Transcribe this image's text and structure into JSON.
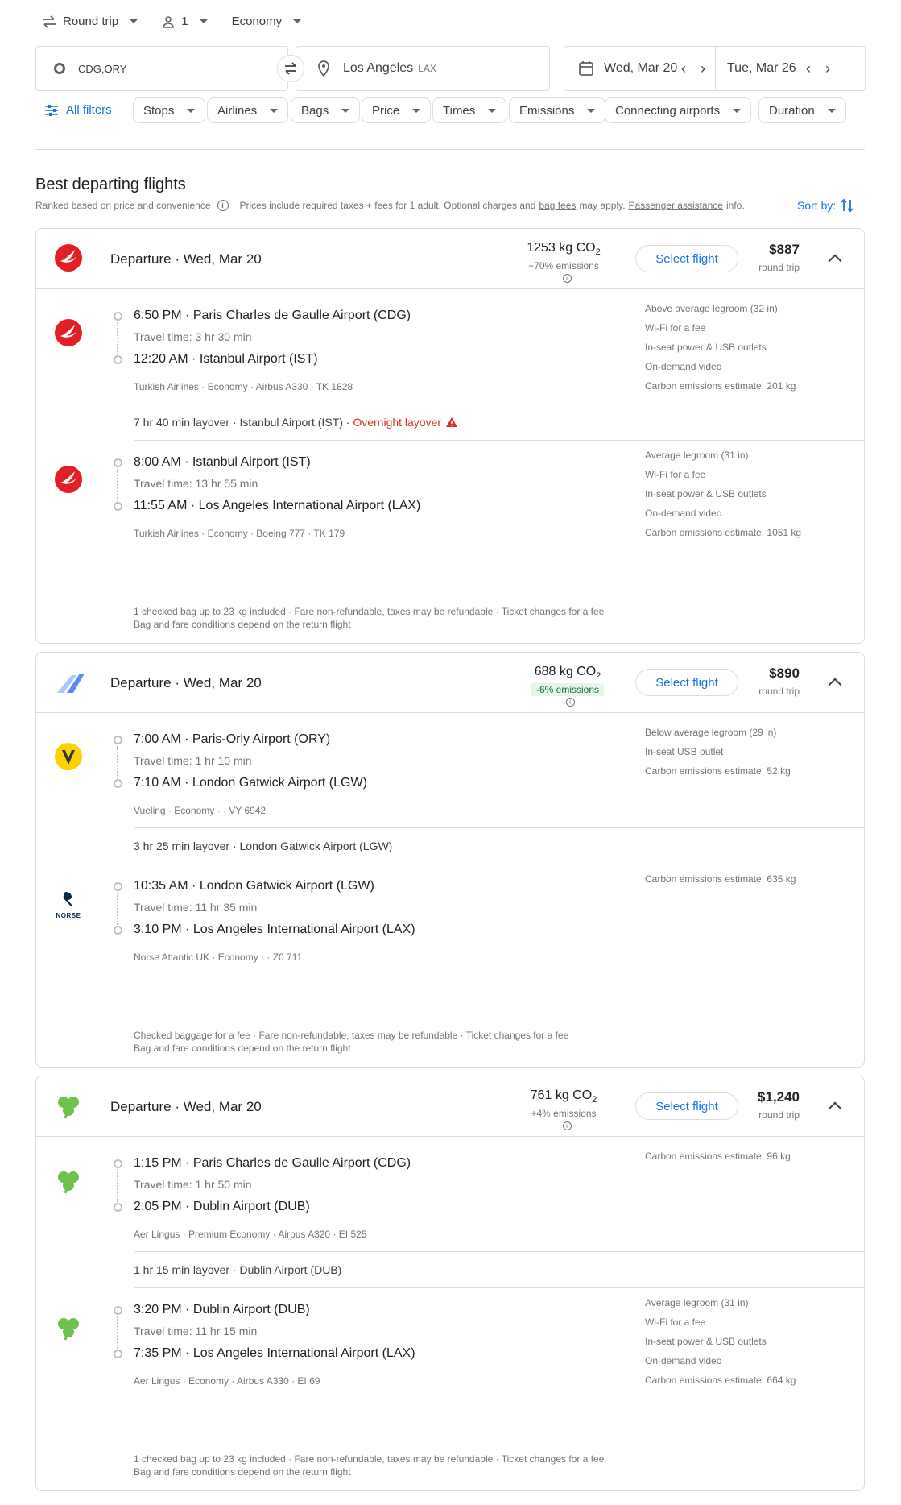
{
  "search": {
    "trip_type": "Round trip",
    "passengers": "1",
    "cabin": "Economy",
    "origin": "CDG,ORY",
    "destination": "Los Angeles",
    "destination_code": "LAX",
    "depart_date": "Wed, Mar 20",
    "return_date": "Tue, Mar 26"
  },
  "filters": {
    "all_filters": "All filters",
    "chips": [
      "Stops",
      "Airlines",
      "Bags",
      "Price",
      "Times",
      "Emissions",
      "Connecting airports",
      "Duration"
    ]
  },
  "results": {
    "heading": "Best departing flights",
    "subtext": "Ranked based on price and convenience",
    "prices_note_1": "Prices include required taxes + fees for 1 adult. Optional charges and",
    "bag_fees_link": "bag fees",
    "prices_note_2": "may apply.",
    "assistance_link": "Passenger assistance",
    "prices_note_3": "info.",
    "sort_by": "Sort by:"
  },
  "colors": {
    "accent": "#1a73e8",
    "turkish_red": "#e21f26",
    "vueling_yellow": "#fcd100",
    "aer_lingus_green": "#6cc24a",
    "warning_red": "#d93025"
  },
  "flights": [
    {
      "departure_label": "Departure",
      "date": "Wed, Mar 20",
      "co2_value": "1253 kg CO",
      "co2_sub": "2",
      "emissions": "+70% emissions",
      "select_label": "Select flight",
      "price": "$887",
      "price_sub": "round trip",
      "segments": [
        {
          "logo": "turkish-airlines-logo",
          "dep_time": "6:50 PM",
          "dep_airport": "Paris Charles de Gaulle Airport (CDG)",
          "travel_time": "Travel time: 3 hr 30 min",
          "arr_time": "12:20 AM",
          "arr_airport": "Istanbul Airport (IST)",
          "meta": "Turkish Airlines · Economy · Airbus A330 · TK 1828",
          "features": [
            "Above average legroom (32 in)",
            "Wi-Fi for a fee",
            "In-seat power & USB outlets",
            "On-demand video",
            "Carbon emissions estimate: 201 kg"
          ]
        },
        {
          "logo": "turkish-airlines-logo",
          "dep_time": "8:00 AM",
          "dep_airport": "Istanbul Airport (IST)",
          "travel_time": "Travel time: 13 hr 55 min",
          "arr_time": "11:55 AM",
          "arr_airport": "Los Angeles International Airport (LAX)",
          "meta": "Turkish Airlines · Economy · Boeing 777 · TK 179",
          "features": [
            "Average legroom (31 in)",
            "Wi-Fi for a fee",
            "In-seat power & USB outlets",
            "On-demand video",
            "Carbon emissions estimate: 1051 kg"
          ]
        }
      ],
      "layover": "7 hr 40 min layover · Istanbul Airport (IST) ·",
      "layover_warning": "Overnight layover",
      "footer_1": "1 checked bag up to 23 kg included · Fare non-refundable, taxes may be refundable · Ticket changes for a fee",
      "footer_2": "Bag and fare conditions depend on the return flight"
    },
    {
      "departure_label": "Departure",
      "date": "Wed, Mar 20",
      "co2_value": "688 kg CO",
      "co2_sub": "2",
      "emissions": "-6% emissions",
      "select_label": "Select flight",
      "price": "$890",
      "price_sub": "round trip",
      "segments": [
        {
          "logo": "vueling-logo",
          "dep_time": "7:00 AM",
          "dep_airport": "Paris-Orly Airport (ORY)",
          "travel_time": "Travel time: 1 hr 10 min",
          "arr_time": "7:10 AM",
          "arr_airport": "London Gatwick Airport (LGW)",
          "meta": "Vueling · Economy · · VY 6942",
          "features": [
            "Below average legroom (29 in)",
            "In-seat USB outlet",
            "Carbon emissions estimate: 52 kg"
          ]
        },
        {
          "logo": "norse-logo",
          "dep_time": "10:35 AM",
          "dep_airport": "London Gatwick Airport (LGW)",
          "travel_time": "Travel time: 11 hr 35 min",
          "arr_time": "3:10 PM",
          "arr_airport": "Los Angeles International Airport (LAX)",
          "meta": "Norse Atlantic UK · Economy · · Z0 711",
          "features": [
            "Carbon emissions estimate: 635 kg"
          ]
        }
      ],
      "layover": "3 hr 25 min layover · London Gatwick Airport (LGW)",
      "footer_1": "Checked baggage for a fee · Fare non-refundable, taxes may be refundable · Ticket changes for a fee",
      "footer_2": "Bag and fare conditions depend on the return flight",
      "norse_text": "NORSE"
    },
    {
      "departure_label": "Departure",
      "date": "Wed, Mar 20",
      "co2_value": "761 kg CO",
      "co2_sub": "2",
      "emissions": "+4% emissions",
      "select_label": "Select flight",
      "price": "$1,240",
      "price_sub": "round trip",
      "segments": [
        {
          "logo": "aer-lingus-logo",
          "dep_time": "1:15 PM",
          "dep_airport": "Paris Charles de Gaulle Airport (CDG)",
          "travel_time": "Travel time: 1 hr 50 min",
          "arr_time": "2:05 PM",
          "arr_airport": "Dublin Airport (DUB)",
          "meta": "Aer Lingus · Premium Economy · Airbus A320 · EI 525",
          "features": [
            "Carbon emissions estimate: 96 kg"
          ]
        },
        {
          "logo": "aer-lingus-logo",
          "dep_time": "3:20 PM",
          "dep_airport": "Dublin Airport (DUB)",
          "travel_time": "Travel time: 11 hr 15 min",
          "arr_time": "7:35 PM",
          "arr_airport": "Los Angeles International Airport (LAX)",
          "meta": "Aer Lingus · Economy · Airbus A330 · EI 69",
          "features": [
            "Average legroom (31 in)",
            "Wi-Fi for a fee",
            "In-seat power & USB outlets",
            "On-demand video",
            "Carbon emissions estimate: 664 kg"
          ]
        }
      ],
      "layover": "1 hr 15 min layover · Dublin Airport (DUB)",
      "footer_1": "1 checked bag up to 23 kg included · Fare non-refundable, taxes may be refundable · Ticket changes for a fee",
      "footer_2": "Bag and fare conditions depend on the return flight"
    }
  ]
}
